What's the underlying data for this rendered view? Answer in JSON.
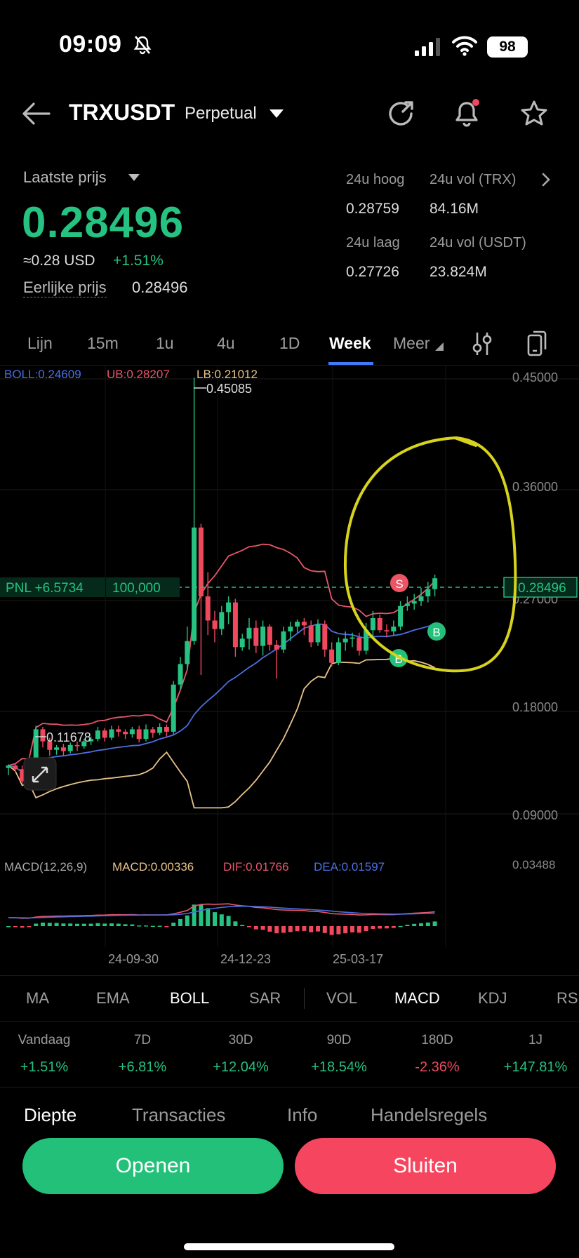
{
  "status": {
    "time": "09:09",
    "battery": "98"
  },
  "header": {
    "pair": "TRXUSDT",
    "contract": "Perpetual"
  },
  "price": {
    "label": "Laatste prijs",
    "last": "0.28496",
    "approx": "≈0.28 USD",
    "change": "+1.51%",
    "fair_label": "Eerlijke prijs",
    "fair_value": "0.28496"
  },
  "stats": {
    "high_label": "24u hoog",
    "high": "0.28759",
    "vol_trx_label": "24u vol (TRX)",
    "vol_trx": "84.16M",
    "low_label": "24u laag",
    "low": "0.27726",
    "vol_usdt_label": "24u vol  (USDT)",
    "vol_usdt": "23.824M"
  },
  "timeframes": [
    "Lijn",
    "15m",
    "1u",
    "4u",
    "1D",
    "Week",
    "Meer"
  ],
  "active_timeframe": "Week",
  "chart_data": {
    "type": "candlestick",
    "boll_label": "BOLL:0.24609",
    "ub_label": "UB:0.28207",
    "lb_label": "LB:0.21012",
    "price_axis": [
      "0.45000",
      "0.36000",
      "0.27000",
      "0.18000",
      "0.09000"
    ],
    "pnl_label": "PNL +6.5734",
    "pnl_size": "100,000",
    "current_price_tag": "0.28496",
    "max_label": "0.45085",
    "min_label": "0.11678",
    "markers": [
      "S",
      "B",
      "B"
    ],
    "macd_label": "MACD(12,26,9)",
    "macd_val": "MACD:0.00336",
    "dif_val": "DIF:0.01766",
    "dea_val": "DEA:0.01597",
    "macd_axis": "0.03488",
    "x_labels": [
      "24-09-30",
      "24-12-23",
      "25-03-17"
    ],
    "ylim": [
      0.09,
      0.45
    ],
    "candles": [
      [
        0.128,
        0.13,
        0.122,
        0.131
      ],
      [
        0.13,
        0.127,
        0.124,
        0.132
      ],
      [
        0.127,
        0.117,
        0.115,
        0.13
      ],
      [
        0.117,
        0.128,
        0.116,
        0.131
      ],
      [
        0.128,
        0.16,
        0.126,
        0.163
      ],
      [
        0.16,
        0.15,
        0.145,
        0.162
      ],
      [
        0.15,
        0.143,
        0.138,
        0.153
      ],
      [
        0.143,
        0.145,
        0.139,
        0.147
      ],
      [
        0.145,
        0.142,
        0.138,
        0.148
      ],
      [
        0.142,
        0.147,
        0.14,
        0.149
      ],
      [
        0.147,
        0.146,
        0.142,
        0.15
      ],
      [
        0.146,
        0.15,
        0.144,
        0.152
      ],
      [
        0.15,
        0.152,
        0.147,
        0.154
      ],
      [
        0.152,
        0.159,
        0.15,
        0.162
      ],
      [
        0.159,
        0.153,
        0.15,
        0.161
      ],
      [
        0.153,
        0.16,
        0.151,
        0.163
      ],
      [
        0.16,
        0.158,
        0.154,
        0.163
      ],
      [
        0.158,
        0.156,
        0.152,
        0.16
      ],
      [
        0.156,
        0.16,
        0.153,
        0.162
      ],
      [
        0.16,
        0.152,
        0.149,
        0.163
      ],
      [
        0.152,
        0.16,
        0.15,
        0.164
      ],
      [
        0.16,
        0.157,
        0.153,
        0.162
      ],
      [
        0.157,
        0.162,
        0.155,
        0.165
      ],
      [
        0.162,
        0.158,
        0.154,
        0.164
      ],
      [
        0.158,
        0.197,
        0.156,
        0.2
      ],
      [
        0.197,
        0.214,
        0.193,
        0.22
      ],
      [
        0.214,
        0.233,
        0.21,
        0.245
      ],
      [
        0.233,
        0.327,
        0.23,
        0.451
      ],
      [
        0.327,
        0.27,
        0.205,
        0.33
      ],
      [
        0.27,
        0.25,
        0.238,
        0.29
      ],
      [
        0.25,
        0.243,
        0.232,
        0.258
      ],
      [
        0.243,
        0.257,
        0.238,
        0.262
      ],
      [
        0.257,
        0.265,
        0.247,
        0.27
      ],
      [
        0.265,
        0.228,
        0.22,
        0.268
      ],
      [
        0.228,
        0.235,
        0.225,
        0.239
      ],
      [
        0.235,
        0.244,
        0.226,
        0.252
      ],
      [
        0.244,
        0.229,
        0.223,
        0.25
      ],
      [
        0.229,
        0.245,
        0.221,
        0.25
      ],
      [
        0.245,
        0.23,
        0.225,
        0.247
      ],
      [
        0.23,
        0.226,
        0.202,
        0.234
      ],
      [
        0.226,
        0.241,
        0.223,
        0.245
      ],
      [
        0.241,
        0.245,
        0.233,
        0.249
      ],
      [
        0.245,
        0.249,
        0.24,
        0.251
      ],
      [
        0.249,
        0.246,
        0.238,
        0.252
      ],
      [
        0.246,
        0.232,
        0.228,
        0.25
      ],
      [
        0.232,
        0.247,
        0.229,
        0.251
      ],
      [
        0.247,
        0.226,
        0.22,
        0.25
      ],
      [
        0.226,
        0.215,
        0.212,
        0.232
      ],
      [
        0.215,
        0.232,
        0.213,
        0.236
      ],
      [
        0.232,
        0.235,
        0.225,
        0.241
      ],
      [
        0.235,
        0.236,
        0.228,
        0.24
      ],
      [
        0.236,
        0.225,
        0.221,
        0.24
      ],
      [
        0.225,
        0.242,
        0.222,
        0.248
      ],
      [
        0.242,
        0.252,
        0.236,
        0.258
      ],
      [
        0.252,
        0.242,
        0.24,
        0.255
      ],
      [
        0.242,
        0.241,
        0.236,
        0.247
      ],
      [
        0.241,
        0.245,
        0.238,
        0.25
      ],
      [
        0.245,
        0.262,
        0.242,
        0.266
      ],
      [
        0.262,
        0.264,
        0.258,
        0.27
      ],
      [
        0.264,
        0.266,
        0.259,
        0.272
      ],
      [
        0.266,
        0.27,
        0.262,
        0.277
      ],
      [
        0.27,
        0.276,
        0.265,
        0.282
      ],
      [
        0.276,
        0.285,
        0.27,
        0.288
      ]
    ]
  },
  "indicators": [
    "MA",
    "EMA",
    "BOLL",
    "SAR",
    "VOL",
    "MACD",
    "KDJ",
    "RS"
  ],
  "active_indicators": [
    "BOLL",
    "MACD"
  ],
  "performance": [
    {
      "label": "Vandaag",
      "value": "+1.51%",
      "trend": "pos"
    },
    {
      "label": "7D",
      "value": "+6.81%",
      "trend": "pos"
    },
    {
      "label": "30D",
      "value": "+12.04%",
      "trend": "pos"
    },
    {
      "label": "90D",
      "value": "+18.54%",
      "trend": "pos"
    },
    {
      "label": "180D",
      "value": "-2.36%",
      "trend": "neg"
    },
    {
      "label": "1J",
      "value": "+147.81%",
      "trend": "pos"
    }
  ],
  "bottom_tabs": [
    "Diepte",
    "Transacties",
    "Info",
    "Handelsregels"
  ],
  "actions": {
    "open": "Openen",
    "close": "Sluiten"
  },
  "colors": {
    "up": "#25c281",
    "down": "#f0495e",
    "accent": "#3e7bfa",
    "annotation": "#d7d31c"
  }
}
